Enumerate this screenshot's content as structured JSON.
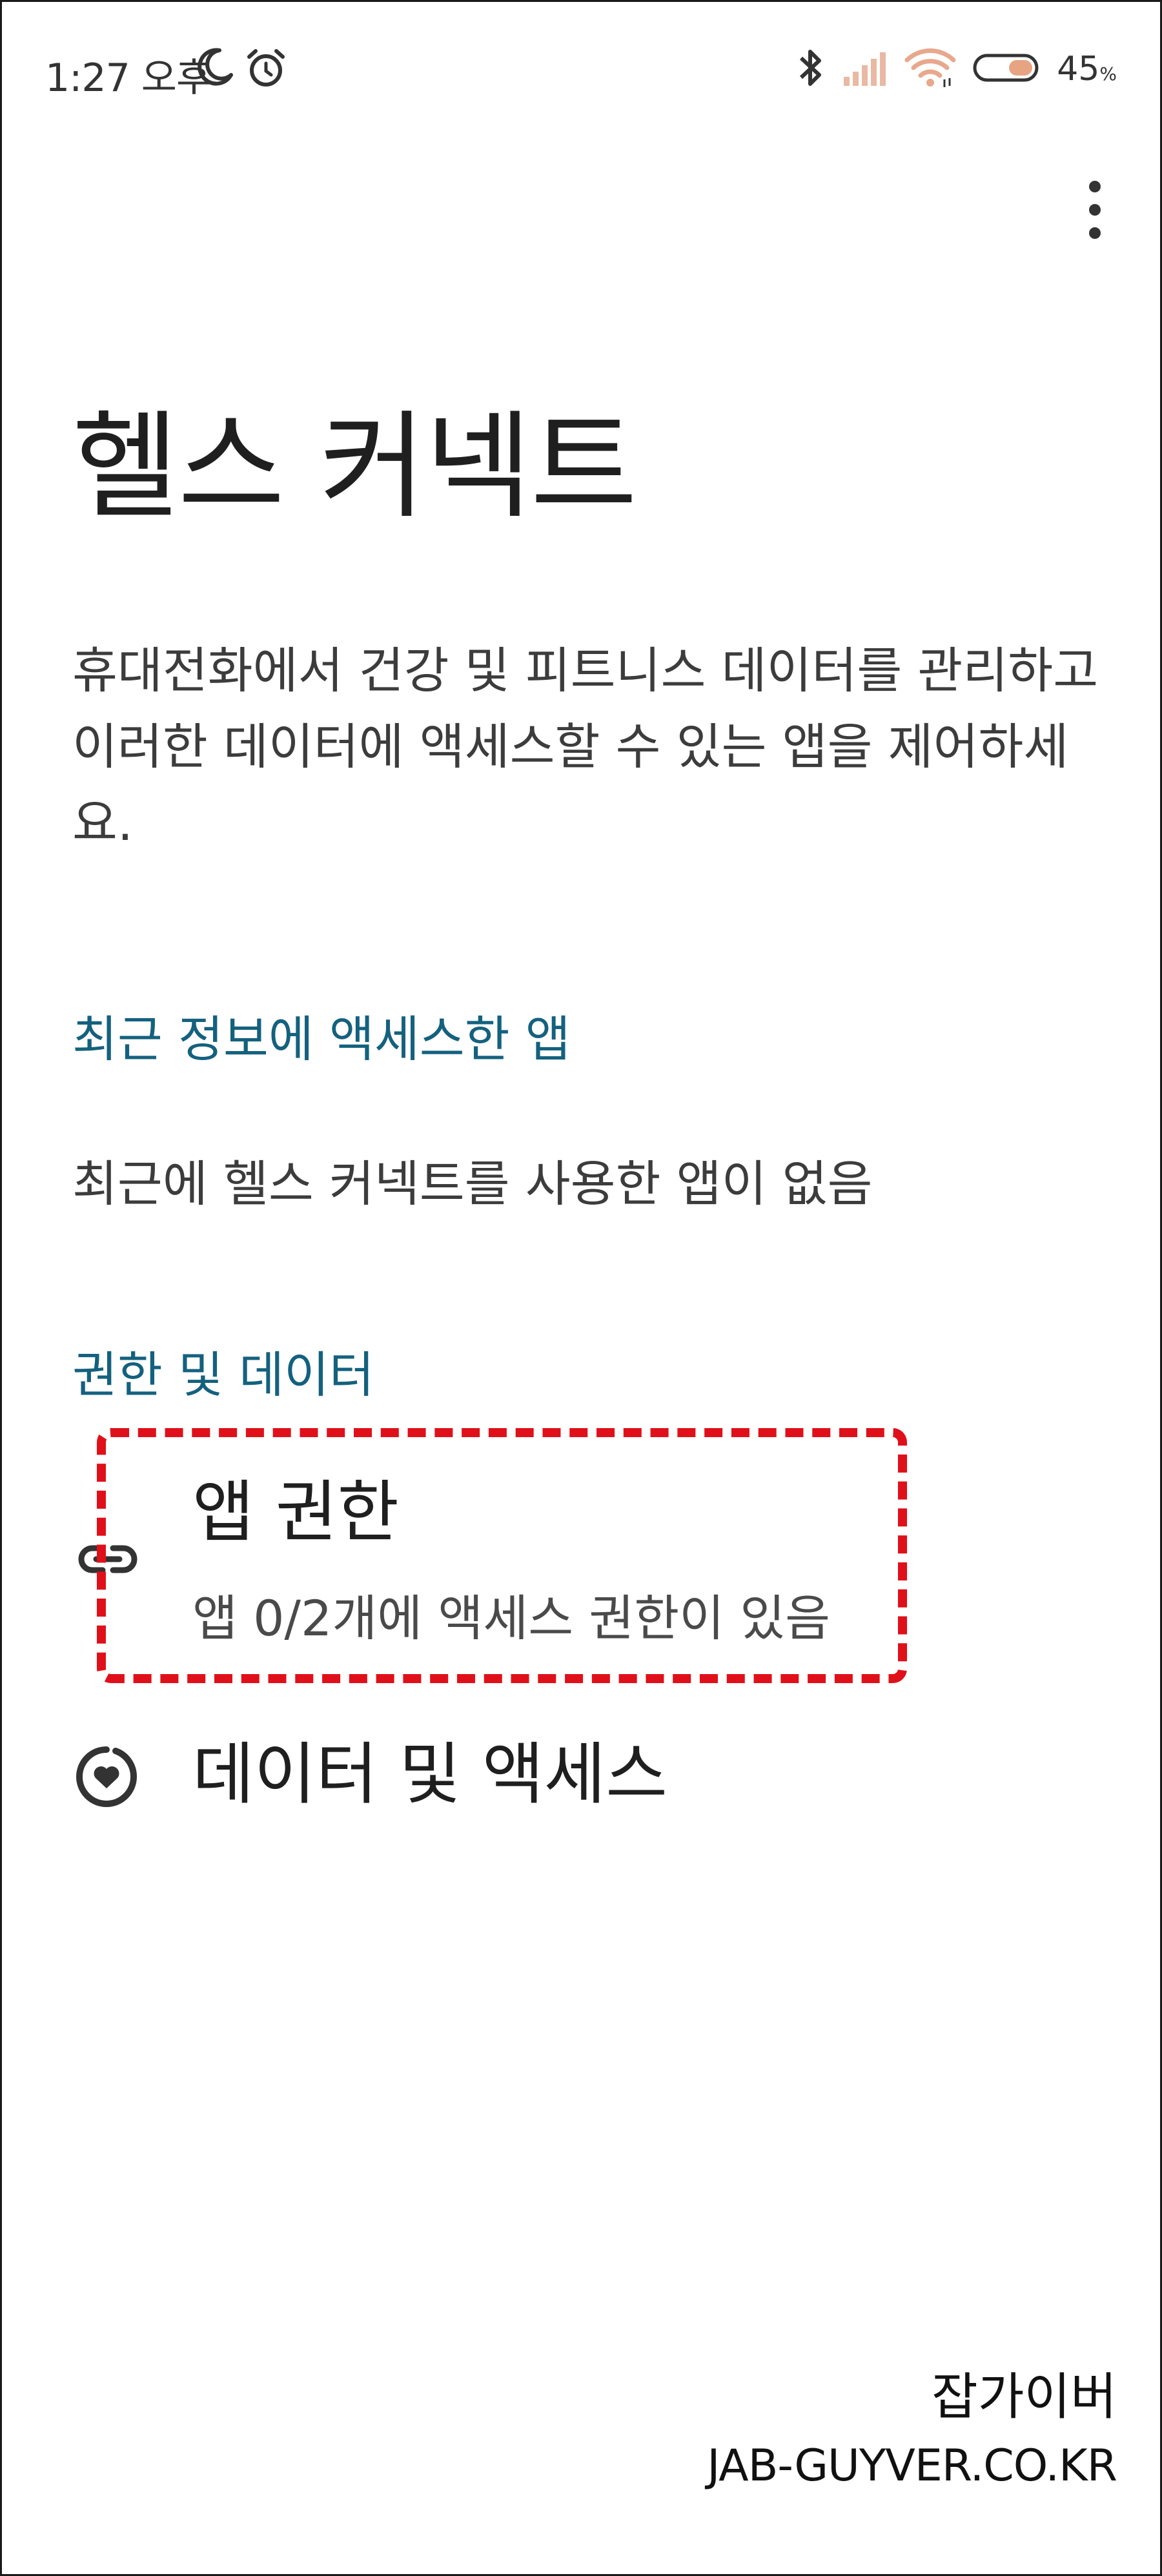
{
  "status_bar": {
    "time": "1:27 오후",
    "battery": "45",
    "battery_unit": "%",
    "icons": [
      "moon-icon",
      "alarm-icon",
      "bluetooth-icon",
      "signal-icon",
      "wifi-icon",
      "battery-icon"
    ]
  },
  "header": {
    "menu_icon": "more-vert-icon"
  },
  "page": {
    "title": "헬스 커넥트",
    "description": "휴대전화에서 건강 및 피트니스 데이터를 관리하고 이러한 데이터에 액세스할 수 있는 앱을 제어하세요."
  },
  "recent_section": {
    "header": "최근 정보에 액세스한 앱",
    "empty_text": "최근에 헬스 커넥트를 사용한 앱이 없음"
  },
  "permissions_section": {
    "header": "권한 및 데이터",
    "items": [
      {
        "title": "앱 권한",
        "subtitle": "앱 0/2개에 액세스 권한이 있음",
        "icon": "link-icon"
      },
      {
        "title": "데이터 및 액세스",
        "icon": "heart-circle-icon"
      }
    ]
  },
  "annotation": {
    "color": "#e0101a"
  },
  "watermark": {
    "korean": "잡가이버",
    "domain": "JAB-GUYVER.CO.KR"
  },
  "colors": {
    "accent": "#14617e",
    "text": "#1f1f1f",
    "background": "#ffffff"
  }
}
